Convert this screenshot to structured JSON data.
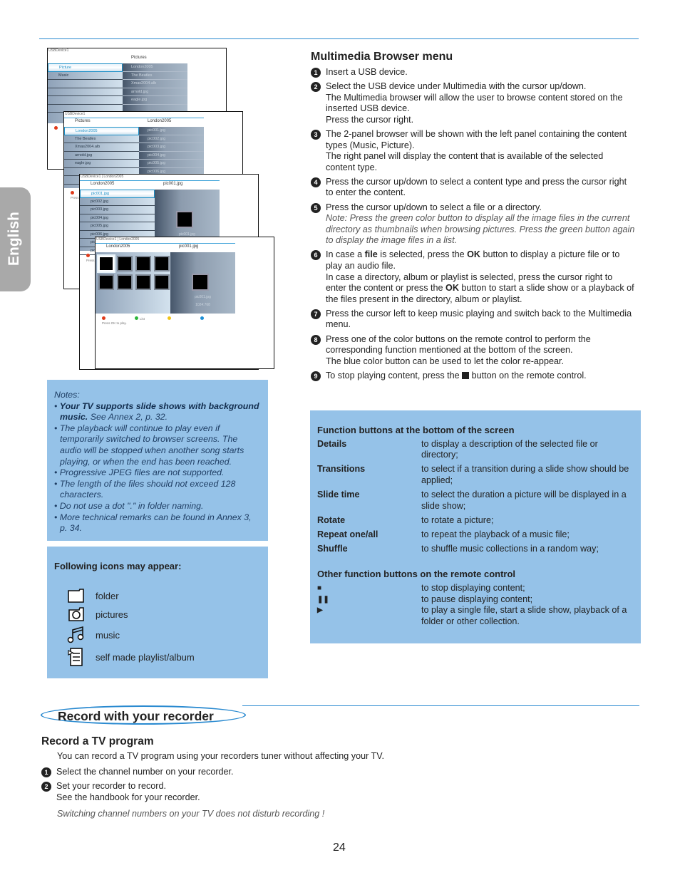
{
  "side_tab": "English",
  "screens": [
    {
      "crumb": "USBDevice1",
      "left_header": "",
      "right_header": "Pictures",
      "left_items": [
        "Picture",
        "Music",
        "",
        "",
        "",
        ""
      ],
      "right_items": [
        "London2005",
        "The Beatles",
        "Xmas2004.alb",
        "arnold.jpg",
        "eagle.jpg",
        "",
        ""
      ]
    },
    {
      "crumb": "USBDevice1",
      "left_header": "Pictures",
      "right_header": "London2005",
      "left_items": [
        "London2005",
        "The Beatles",
        "Xmas2004.alb",
        "arnold.jpg",
        "eagle.jpg",
        "",
        ""
      ],
      "right_items": [
        "pic001.jpg",
        "pic002.jpg",
        "pic003.jpg",
        "pic004.jpg",
        "pic005.jpg",
        "pic006.jpg"
      ],
      "footer": "Press"
    },
    {
      "crumb": "USBDevice1 | London2005",
      "left_header": "London2005",
      "right_header": "pic001.jpg",
      "left_items": [
        "pic001.jpg",
        "pic002.jpg",
        "pic003.jpg",
        "pic004.jpg",
        "pic005.jpg",
        "pic006.jpg",
        "pic",
        "pic"
      ],
      "preview_name": "pic001.jpg",
      "preview_size": "1024:768",
      "footer": "Press"
    },
    {
      "crumb": "USBDevice1 | London2005",
      "left_header": "London2005",
      "right_header": "pic001.jpg",
      "preview_name": "pic001.jpg",
      "preview_size": "1024:768",
      "green_label": "List",
      "footer": "Press OK to play."
    }
  ],
  "notes": {
    "label": "Notes:",
    "items": [
      {
        "bold": "Your TV supports slide shows with background music.",
        "text": " See Annex 2, p. 32."
      },
      {
        "text": "The playback will continue to play even if temporarily switched to browser screens. The audio will be stopped when another song starts playing, or when the end has been reached."
      },
      {
        "text": "Progressive JPEG files are not supported."
      },
      {
        "text": "The length of the files should not exceed 128 characters."
      },
      {
        "text": "Do not use a dot \".\" in folder naming."
      },
      {
        "text": "More technical remarks can be found in Annex 3, p. 34."
      }
    ]
  },
  "icons": {
    "title": "Following icons may appear:",
    "items": [
      {
        "icon": "folder-icon",
        "label": "folder"
      },
      {
        "icon": "camera-icon",
        "label": "pictures"
      },
      {
        "icon": "music-note-icon",
        "label": "music"
      },
      {
        "icon": "playlist-icon",
        "label": "self made playlist/album"
      }
    ]
  },
  "browser": {
    "title": "Multimedia Browser menu",
    "steps": [
      {
        "n": "1",
        "lines": [
          "Insert a USB device."
        ]
      },
      {
        "n": "2",
        "lines": [
          "Select the USB device under Multimedia with the cursor up/down.",
          "The Multimedia browser will allow the user to browse content stored on the inserted USB device.",
          "Press the cursor right."
        ]
      },
      {
        "n": "3",
        "lines": [
          "The 2-panel browser will be shown with the left panel containing the content types (Music, Picture).",
          "The right panel will display the content that is available of the selected content type."
        ]
      },
      {
        "n": "4",
        "lines": [
          "Press the cursor up/down to select a content type and press the cursor right to enter the content."
        ]
      },
      {
        "n": "5",
        "lines": [
          "Press the cursor up/down to select a file or a directory."
        ],
        "note": "Note: Press the green color button to display all the image files in the current directory as thumbnails when browsing pictures. Press the green button again to display the image files in a list."
      },
      {
        "n": "6",
        "a": "In case a ",
        "b": "file",
        "c": " is selected, press the ",
        "d": "OK",
        "e": " button to display a picture file or to play an audio file.",
        "f": "In case a directory, album or playlist is selected, press the cursor right to enter the content or press the ",
        "g": "OK",
        "h": " button to start a slide show or a playback of the files present in the directory, album or playlist."
      },
      {
        "n": "7",
        "lines": [
          "Press the cursor left to keep music playing and switch back to the Multimedia menu."
        ]
      },
      {
        "n": "8",
        "lines": [
          "Press one of the color buttons on the remote control to perform the corresponding function mentioned at the bottom of the screen.",
          "The blue color button can be used to let the color re-appear."
        ]
      },
      {
        "n": "9",
        "pre": "To stop playing content, press the ",
        "post": " button on the remote control."
      }
    ]
  },
  "functions": {
    "title": "Function buttons at the bottom of the screen",
    "rows": [
      {
        "k": "Details",
        "v": "to display a description of the selected file or directory;"
      },
      {
        "k": "Transitions",
        "v": "to select if a transition during a slide show should be applied;"
      },
      {
        "k": "Slide time",
        "v": "to select the duration a picture will be displayed in a slide show;"
      },
      {
        "k": "Rotate",
        "v": "to rotate a picture;"
      },
      {
        "k": "Repeat one/all",
        "v": "to repeat the playback of a music file;"
      },
      {
        "k": "Shuffle",
        "v": "to shuffle music collections in a random way;"
      }
    ],
    "other_title": "Other function buttons on the remote control",
    "other": [
      {
        "icon": "stop-icon",
        "sym": "■",
        "v": "to stop displaying content;"
      },
      {
        "icon": "pause-icon",
        "sym": "❚❚",
        "v": "to pause displaying content;"
      },
      {
        "icon": "play-icon",
        "sym": "▶",
        "v": "to play a single file, start a slide show, playback of a folder or other collection."
      }
    ]
  },
  "record": {
    "section": "Record with your recorder",
    "title": "Record a TV program",
    "intro": "You can record a TV program using your recorders tuner without affecting your TV.",
    "steps": [
      {
        "n": "1",
        "lines": [
          "Select the channel number on your recorder."
        ]
      },
      {
        "n": "2",
        "lines": [
          "Set your recorder to record.",
          "See the handbook for your recorder."
        ]
      }
    ],
    "note": "Switching channel numbers on your TV does not disturb recording !"
  },
  "page_number": "24",
  "colors": {
    "accent": "#2a8ad0",
    "box": "#95c2e8",
    "tab": "#a9a9a9"
  }
}
